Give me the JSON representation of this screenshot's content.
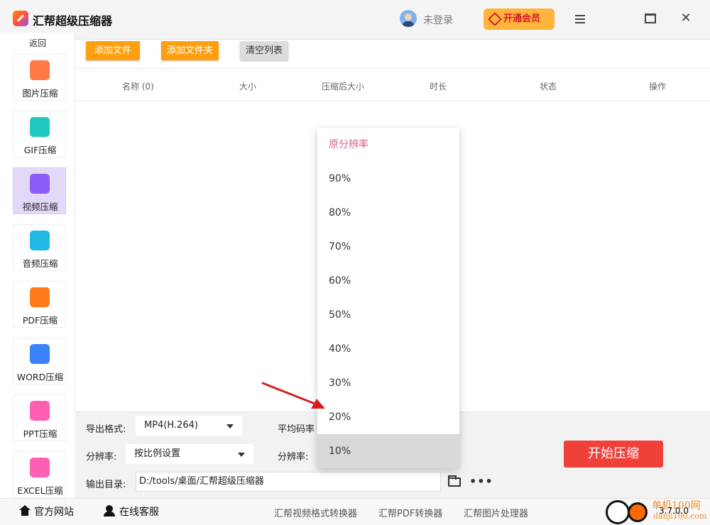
{
  "titlebar": {
    "app_title": "汇帮超级压缩器",
    "login_text": "未登录",
    "vip_label": "开通会员"
  },
  "sidebar": {
    "back_label": "返回",
    "items": [
      {
        "label": "图片压缩",
        "icon": "image-icon",
        "color": "#ff7a45"
      },
      {
        "label": "GIF压缩",
        "icon": "gif-icon",
        "color": "#1fc8c0"
      },
      {
        "label": "视频压缩",
        "icon": "video-icon",
        "color": "#8b5cf6"
      },
      {
        "label": "音频压缩",
        "icon": "audio-icon",
        "color": "#22b8e6"
      },
      {
        "label": "PDF压缩",
        "icon": "pdf-icon",
        "color": "#ff7a1a"
      },
      {
        "label": "WORD压缩",
        "icon": "word-icon",
        "color": "#3b82f6"
      },
      {
        "label": "PPT压缩",
        "icon": "ppt-icon",
        "color": "#ff5fb2"
      },
      {
        "label": "EXCEL压缩",
        "icon": "excel-icon",
        "color": "#ff5fb2"
      }
    ],
    "active_index": 2
  },
  "toolbar": {
    "add_file": "添加文件",
    "add_folder": "添加文件夹",
    "clear_list": "清空列表"
  },
  "table": {
    "columns": [
      "名称 (0)",
      "大小",
      "压缩后大小",
      "时长",
      "状态",
      "操作"
    ]
  },
  "settings": {
    "format_label": "导出格式:",
    "format_value": "MP4(H.264)",
    "bitrate_label": "平均码率",
    "resolution_label": "分辨率:",
    "resolution_value": "按比例设置",
    "resolution_label2": "分辨率:",
    "output_label": "输出目录:",
    "output_value": "D:/tools/桌面/汇帮超级压缩器",
    "start_button": "开始压缩"
  },
  "dropdown": {
    "options": [
      "原分辨率",
      "90%",
      "80%",
      "70%",
      "60%",
      "50%",
      "40%",
      "30%",
      "20%",
      "10%"
    ],
    "selected_index": 0,
    "hover_index": 9
  },
  "footer": {
    "website": "官方网站",
    "service": "在线客服",
    "links": [
      "汇帮视频格式转换器",
      "汇帮PDF转换器",
      "汇帮图片处理器"
    ],
    "version": "3.7.0.0",
    "watermark": "单机100网",
    "watermark_sub": "danji100.com"
  },
  "colors": {
    "accent_orange": "#ff9f0f",
    "start_red": "#f0403a",
    "active_sidebar": "#e3d8f8",
    "selected_option": "#e05a8a",
    "arrow": "#d62020"
  }
}
